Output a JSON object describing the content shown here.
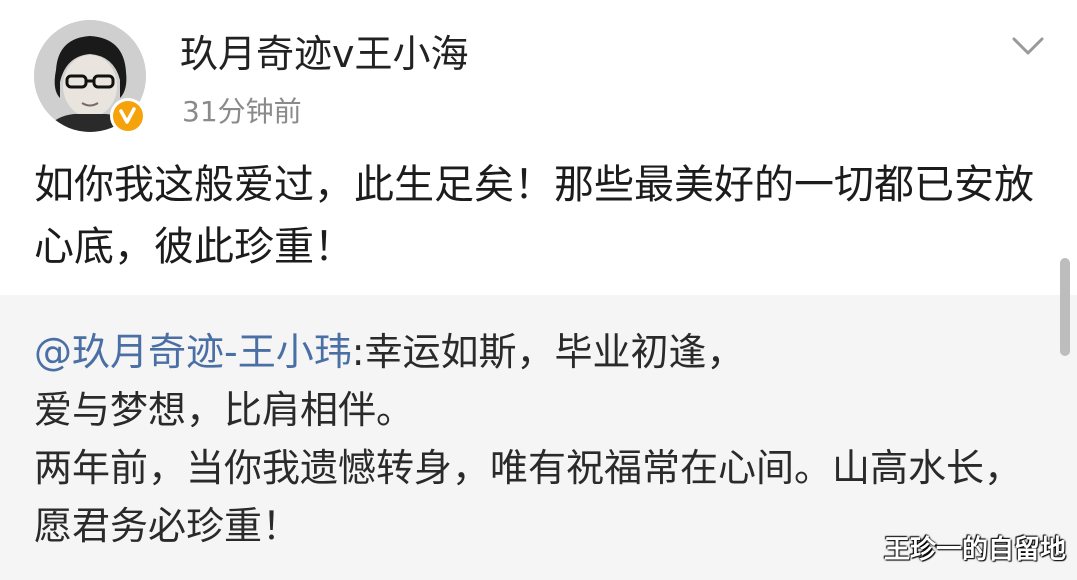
{
  "post": {
    "author_name": "玖月奇迹v王小海",
    "time": "31分钟前",
    "text": "如你我这般爱过，此生足矣！那些最美好的一切都已安放心底，彼此珍重！",
    "avatar_icon": "user-avatar-icon",
    "verified_icon": "verified-badge-icon",
    "more_icon": "chevron-down-icon"
  },
  "repost": {
    "mention": "@玖月奇迹-王小玮",
    "line1": ":幸运如斯，毕业初逢，",
    "line2": "爱与梦想，比肩相伴。",
    "line3": "两年前，当你我遗憾转身，唯有祝福常在心间。山高水长，愿君务必珍重！"
  },
  "watermark": {
    "text": "王珍一的自留地"
  },
  "colors": {
    "mention": "#4a6fa5",
    "verified": "#f6a20b",
    "repost_background": "#f5f5f5",
    "time": "#8a8a8a"
  }
}
